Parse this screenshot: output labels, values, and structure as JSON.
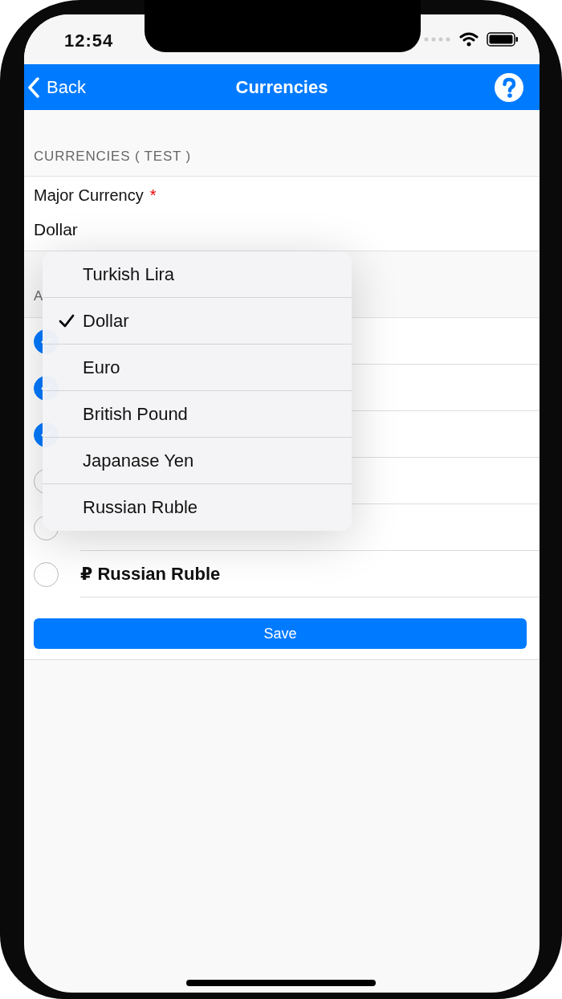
{
  "status_bar": {
    "time": "12:54"
  },
  "nav": {
    "back": "Back",
    "title": "Currencies"
  },
  "section": {
    "header": "CURRENCIES ( TEST )"
  },
  "field": {
    "label": "Major Currency",
    "required_mark": "*",
    "value": "Dollar"
  },
  "list": {
    "header": "A",
    "items": [
      {
        "checked": true
      },
      {
        "checked": true
      },
      {
        "checked": true
      },
      {
        "checked": false
      },
      {
        "checked": false
      },
      {
        "checked": false,
        "symbol": "₽",
        "name": "Russian Ruble"
      }
    ]
  },
  "save_button": "Save",
  "dropdown": {
    "options": [
      {
        "label": "Turkish Lira",
        "selected": false
      },
      {
        "label": "Dollar",
        "selected": true
      },
      {
        "label": "Euro",
        "selected": false
      },
      {
        "label": "British Pound",
        "selected": false
      },
      {
        "label": "Japanase Yen",
        "selected": false
      },
      {
        "label": "Russian Ruble",
        "selected": false
      }
    ]
  }
}
